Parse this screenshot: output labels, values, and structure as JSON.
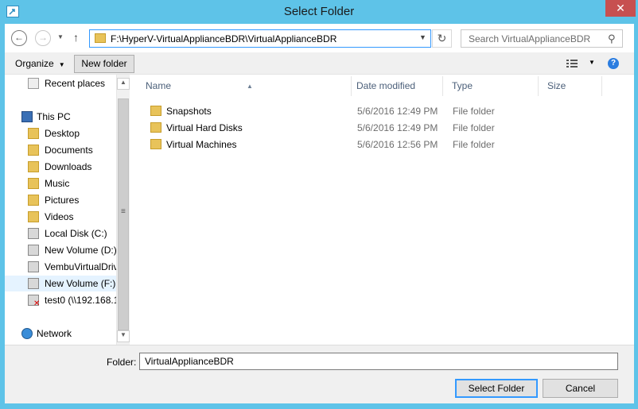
{
  "window": {
    "title": "Select Folder",
    "close_label": "✕"
  },
  "address": {
    "path": "F:\\HyperV-VirtualApplianceBDR\\VirtualApplianceBDR",
    "search_placeholder": "Search VirtualApplianceBDR"
  },
  "toolbar": {
    "organize_label": "Organize",
    "new_folder_label": "New folder",
    "help_label": "?"
  },
  "nav": {
    "items": [
      {
        "label": "Recent places"
      },
      {
        "label": "This PC"
      },
      {
        "label": "Desktop"
      },
      {
        "label": "Documents"
      },
      {
        "label": "Downloads"
      },
      {
        "label": "Music"
      },
      {
        "label": "Pictures"
      },
      {
        "label": "Videos"
      },
      {
        "label": "Local Disk (C:)"
      },
      {
        "label": "New Volume (D:)"
      },
      {
        "label": "VembuVirtualDrive"
      },
      {
        "label": "New Volume (F:)"
      },
      {
        "label": "test0 (\\\\192.168.1"
      },
      {
        "label": "Network"
      }
    ],
    "selected": "New Volume (F:)"
  },
  "columns": {
    "name": "Name",
    "date": "Date modified",
    "type": "Type",
    "size": "Size"
  },
  "files": [
    {
      "name": "Snapshots",
      "date": "5/6/2016 12:49 PM",
      "type": "File folder"
    },
    {
      "name": "Virtual Hard Disks",
      "date": "5/6/2016 12:49 PM",
      "type": "File folder"
    },
    {
      "name": "Virtual Machines",
      "date": "5/6/2016 12:56 PM",
      "type": "File folder"
    }
  ],
  "footer": {
    "folder_label": "Folder:",
    "folder_value": "VirtualApplianceBDR",
    "select_label": "Select Folder",
    "cancel_label": "Cancel"
  },
  "colors": {
    "titlebar": "#5ec3e8",
    "close": "#c75050",
    "accent": "#3399ff",
    "folder": "#e8c35a"
  }
}
